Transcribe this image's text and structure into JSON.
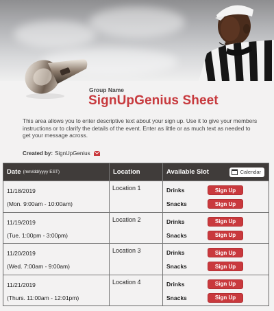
{
  "header": {
    "group_label": "Group Name",
    "title": "SignUpGenius Sheet",
    "description": "This area allows you to enter descriptive text about your sign up. Use it to give your members instructions or to clarify the details of the event. Enter as little or as much text as needed to get your message across.",
    "created_by_label": "Created by:",
    "created_by_name": "SignUpGenius",
    "accent_color": "#c7393d"
  },
  "table": {
    "columns": {
      "date": "Date",
      "date_format": "(mm/dd/yyyy EST)",
      "location": "Location",
      "slot": "Available Slot",
      "calendar_button": "Calendar"
    },
    "rows": [
      {
        "date": "11/18/2019",
        "time": "(Mon. 9:00am - 10:00am)",
        "location": "Location 1",
        "slots": [
          {
            "name": "Drinks",
            "button": "Sign Up"
          },
          {
            "name": "Snacks",
            "button": "Sign Up"
          }
        ]
      },
      {
        "date": "11/19/2019",
        "time": "(Tue. 1:00pm - 3:00pm)",
        "location": "Location 2",
        "slots": [
          {
            "name": "Drinks",
            "button": "Sign Up"
          },
          {
            "name": "Snacks",
            "button": "Sign Up"
          }
        ]
      },
      {
        "date": "11/20/2019",
        "time": "(Wed. 7:00am - 9:00am)",
        "location": "Location 3",
        "slots": [
          {
            "name": "Drinks",
            "button": "Sign Up"
          },
          {
            "name": "Snacks",
            "button": "Sign Up"
          }
        ]
      },
      {
        "date": "11/21/2019",
        "time": "(Thurs. 11:00am - 12:01pm)",
        "location": "Location 4",
        "slots": [
          {
            "name": "Drinks",
            "button": "Sign Up"
          },
          {
            "name": "Snacks",
            "button": "Sign Up"
          }
        ]
      }
    ]
  },
  "icons": {
    "mail": "mail-icon",
    "calendar": "calendar-icon",
    "whistle": "whistle-image",
    "referee": "referee-image"
  },
  "colors": {
    "button_red": "#c9393d",
    "table_header": "#403c3a"
  }
}
